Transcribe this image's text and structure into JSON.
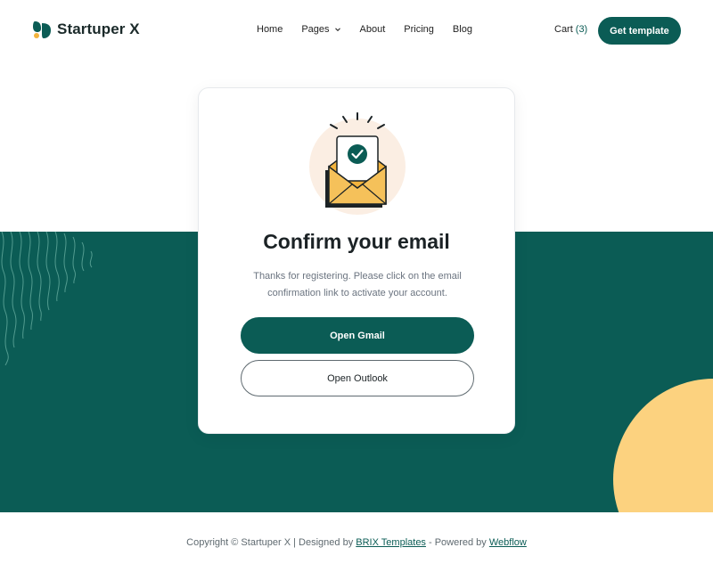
{
  "brand": {
    "name": "Startuper X",
    "icon": "leaf-logo-icon"
  },
  "nav": {
    "items": [
      {
        "label": "Home"
      },
      {
        "label": "Pages",
        "has_dropdown": true
      },
      {
        "label": "About"
      },
      {
        "label": "Pricing"
      },
      {
        "label": "Blog"
      }
    ]
  },
  "cart": {
    "label": "Cart",
    "count": "(3)"
  },
  "header": {
    "cta_label": "Get template"
  },
  "card": {
    "title": "Confirm your email",
    "body": "Thanks for registering. Please click on the email confirmation link to activate your account.",
    "primary_button": "Open Gmail",
    "secondary_button": "Open Outlook",
    "illustration_icon": "open-envelope-check-icon"
  },
  "footer": {
    "prefix": "Copyright © Startuper X | Designed by ",
    "designer_link": "BRIX Templates",
    "middle": " - Powered by ",
    "platform_link": "Webflow"
  },
  "colors": {
    "primary": "#0b5c55",
    "accent": "#fcd27f",
    "illustration_bg": "#fbeee3",
    "envelope": "#f2b33d"
  }
}
